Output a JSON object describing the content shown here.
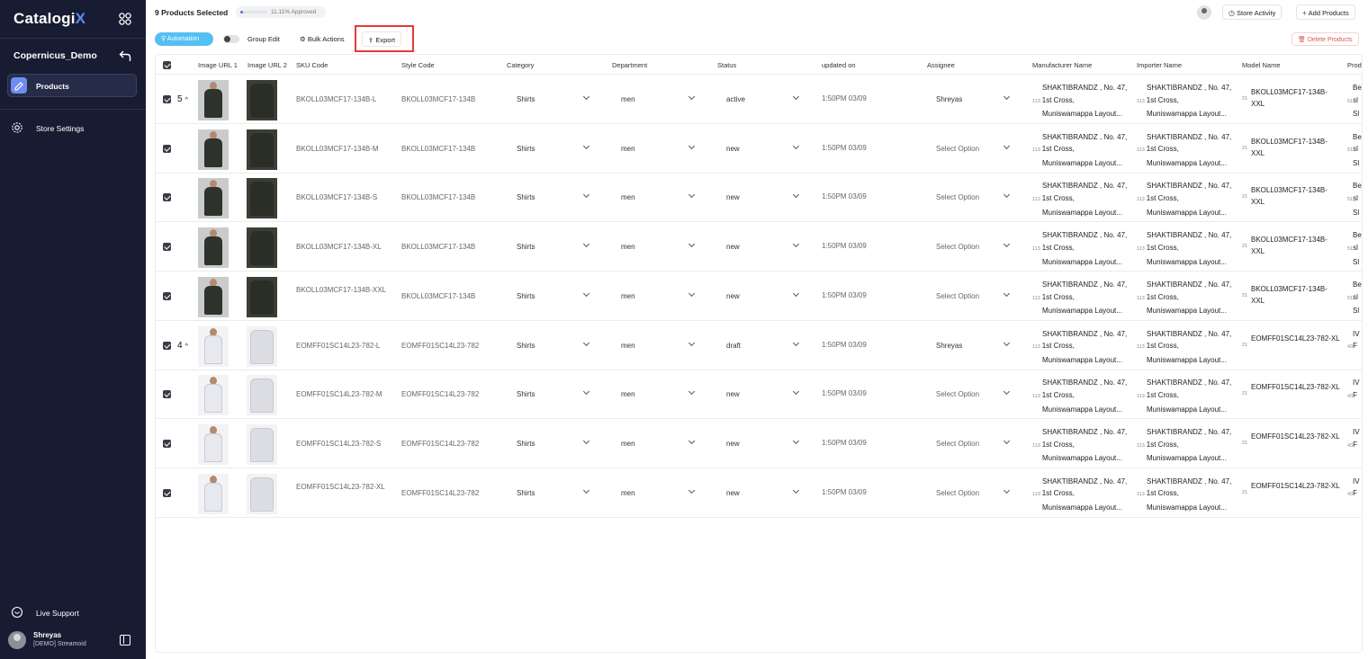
{
  "app": {
    "logo_text": "Catalogi",
    "logo_x": "X",
    "store_name": "Copernicus_Demo"
  },
  "sidebar": {
    "products_label": "Products",
    "store_settings_label": "Store Settings",
    "live_support_label": "Live Support",
    "user_name": "Shreyas",
    "user_org": "[DEMO] Streamoid"
  },
  "header": {
    "selected_count": "9 Products Selected",
    "approved_text": "11.11% Approved",
    "approved_fraction": 0.1111,
    "store_activity_label": "Store Activity",
    "add_products_label": "Add Products"
  },
  "toolbar": {
    "automation_label": "Automation",
    "group_edit_label": "Group Edit",
    "bulk_actions_label": "Bulk Actions",
    "export_label": "Export",
    "delete_label": "Delete Products"
  },
  "columns": {
    "image1": "Image URL 1",
    "image2": "Image URL 2",
    "sku": "SKU Code",
    "style": "Style Code",
    "category": "Category",
    "department": "Department",
    "status": "Status",
    "updated": "updated on",
    "assignee": "Assignee",
    "manufacturer": "Manufacturer Name",
    "importer": "Importer Name",
    "model": "Model Name",
    "product": "Prod"
  },
  "address": {
    "line1": "SHAKTIBRANDZ , No. 47,",
    "num": "113",
    "line2": "1st Cross,",
    "line3": "Muniswamappa Layout..."
  },
  "rows": [
    {
      "group": "5",
      "sku": "BKOLL03MCF17-134B-L",
      "style": "BKOLL03MCF17-134B",
      "category": "Shirts",
      "department": "men",
      "status": "active",
      "updated": "1:50PM 03/09",
      "assignee": "Shreyas",
      "model_num": "21",
      "model": "BKOLL03MCF17-134B-XXL",
      "prod_num": "51",
      "prod1": "Be",
      "prod2": "sl",
      "prod3": "Sl"
    },
    {
      "group": "",
      "sku": "BKOLL03MCF17-134B-M",
      "style": "BKOLL03MCF17-134B",
      "category": "Shirts",
      "department": "men",
      "status": "new",
      "updated": "1:50PM 03/09",
      "assignee": "Select Option",
      "model_num": "21",
      "model": "BKOLL03MCF17-134B-XXL",
      "prod_num": "51",
      "prod1": "Be",
      "prod2": "sl",
      "prod3": "Sl"
    },
    {
      "group": "",
      "sku": "BKOLL03MCF17-134B-S",
      "style": "BKOLL03MCF17-134B",
      "category": "Shirts",
      "department": "men",
      "status": "new",
      "updated": "1:50PM 03/09",
      "assignee": "Select Option",
      "model_num": "21",
      "model": "BKOLL03MCF17-134B-XXL",
      "prod_num": "51",
      "prod1": "Be",
      "prod2": "sl",
      "prod3": "Sl"
    },
    {
      "group": "",
      "sku": "BKOLL03MCF17-134B-XL",
      "style": "BKOLL03MCF17-134B",
      "category": "Shirts",
      "department": "men",
      "status": "new",
      "updated": "1:50PM 03/09",
      "assignee": "Select Option",
      "model_num": "21",
      "model": "BKOLL03MCF17-134B-XXL",
      "prod_num": "51",
      "prod1": "Be",
      "prod2": "sl",
      "prod3": "Sl"
    },
    {
      "group": "",
      "sku": "BKOLL03MCF17-134B-XXL",
      "style": "BKOLL03MCF17-134B",
      "category": "Shirts",
      "department": "men",
      "status": "new",
      "updated": "1:50PM 03/09",
      "assignee": "Select Option",
      "model_num": "21",
      "model": "BKOLL03MCF17-134B-XXL",
      "prod_num": "51",
      "prod1": "Be",
      "prod2": "sl",
      "prod3": "Sl"
    },
    {
      "group": "4",
      "sku": "EOMFF01SC14L23-782-L",
      "style": "EOMFF01SC14L23-782",
      "category": "Shirts",
      "department": "men",
      "status": "draft",
      "updated": "1:50PM 03/09",
      "assignee": "Shreyas",
      "model_num": "21",
      "model": "EOMFF01SC14L23-782-XL",
      "prod_num": "43",
      "prod1": "IV",
      "prod2": "F",
      "prod3": ""
    },
    {
      "group": "",
      "sku": "EOMFF01SC14L23-782-M",
      "style": "EOMFF01SC14L23-782",
      "category": "Shirts",
      "department": "men",
      "status": "new",
      "updated": "1:50PM 03/09",
      "assignee": "Select Option",
      "model_num": "21",
      "model": "EOMFF01SC14L23-782-XL",
      "prod_num": "43",
      "prod1": "IV",
      "prod2": "F",
      "prod3": ""
    },
    {
      "group": "",
      "sku": "EOMFF01SC14L23-782-S",
      "style": "EOMFF01SC14L23-782",
      "category": "Shirts",
      "department": "men",
      "status": "new",
      "updated": "1:50PM 03/09",
      "assignee": "Select Option",
      "model_num": "21",
      "model": "EOMFF01SC14L23-782-XL",
      "prod_num": "43",
      "prod1": "IV",
      "prod2": "F",
      "prod3": ""
    },
    {
      "group": "",
      "sku": "EOMFF01SC14L23-782-XL",
      "style": "EOMFF01SC14L23-782",
      "category": "Shirts",
      "department": "men",
      "status": "new",
      "updated": "1:50PM 03/09",
      "assignee": "Select Option",
      "model_num": "21",
      "model": "EOMFF01SC14L23-782-XL",
      "prod_num": "43",
      "prod1": "IV",
      "prod2": "F",
      "prod3": ""
    }
  ],
  "colors": {
    "sidebar_bg": "#181c32",
    "automation": "#54bff2",
    "accent": "#5e8cf7",
    "delete": "#e05555",
    "highlight": "#e53935"
  }
}
